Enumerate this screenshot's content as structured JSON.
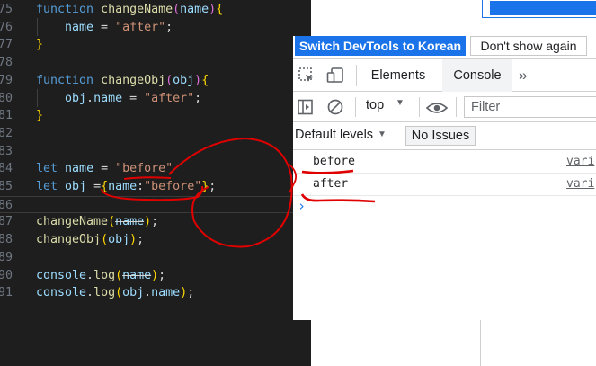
{
  "editor": {
    "lines": [
      {
        "num": "75",
        "tokens": [
          {
            "t": "function",
            "c": "kw"
          },
          {
            "t": " ",
            "c": "plain"
          },
          {
            "t": "changeName",
            "c": "fn"
          },
          {
            "t": "(",
            "c": "brace2"
          },
          {
            "t": "name",
            "c": "var"
          },
          {
            "t": ")",
            "c": "brace2"
          },
          {
            "t": "{",
            "c": "brace1"
          }
        ]
      },
      {
        "num": "76",
        "tokens": [
          {
            "t": "    name",
            "c": "var"
          },
          {
            "t": " = ",
            "c": "plain"
          },
          {
            "t": "\"after\"",
            "c": "str"
          },
          {
            "t": ";",
            "c": "plain"
          }
        ]
      },
      {
        "num": "77",
        "tokens": [
          {
            "t": "}",
            "c": "brace1"
          }
        ]
      },
      {
        "num": "78",
        "tokens": []
      },
      {
        "num": "79",
        "tokens": [
          {
            "t": "function",
            "c": "kw"
          },
          {
            "t": " ",
            "c": "plain"
          },
          {
            "t": "changeObj",
            "c": "fn"
          },
          {
            "t": "(",
            "c": "brace2"
          },
          {
            "t": "obj",
            "c": "var"
          },
          {
            "t": ")",
            "c": "brace2"
          },
          {
            "t": "{",
            "c": "brace1"
          }
        ]
      },
      {
        "num": "80",
        "tokens": [
          {
            "t": "    obj",
            "c": "var"
          },
          {
            "t": ".",
            "c": "plain"
          },
          {
            "t": "name",
            "c": "var"
          },
          {
            "t": " = ",
            "c": "plain"
          },
          {
            "t": "\"after\"",
            "c": "str"
          },
          {
            "t": ";",
            "c": "plain"
          }
        ]
      },
      {
        "num": "81",
        "tokens": [
          {
            "t": "}",
            "c": "brace1"
          }
        ]
      },
      {
        "num": "82",
        "tokens": []
      },
      {
        "num": "83",
        "tokens": []
      },
      {
        "num": "84",
        "tokens": [
          {
            "t": "let",
            "c": "kw"
          },
          {
            "t": " ",
            "c": "plain"
          },
          {
            "t": "name",
            "c": "var"
          },
          {
            "t": " = ",
            "c": "plain"
          },
          {
            "t": "\"before\"",
            "c": "str"
          }
        ]
      },
      {
        "num": "85",
        "tokens": [
          {
            "t": "let",
            "c": "kw"
          },
          {
            "t": " ",
            "c": "plain"
          },
          {
            "t": "obj",
            "c": "var"
          },
          {
            "t": " =",
            "c": "plain"
          },
          {
            "t": "{",
            "c": "brace1"
          },
          {
            "t": "name",
            "c": "var"
          },
          {
            "t": ":",
            "c": "plain"
          },
          {
            "t": "\"before\"",
            "c": "str"
          },
          {
            "t": "}",
            "c": "brace1"
          },
          {
            "t": ";",
            "c": "plain"
          }
        ]
      },
      {
        "num": "86",
        "tokens": [],
        "current": true
      },
      {
        "num": "87",
        "tokens": [
          {
            "t": "changeName",
            "c": "fn"
          },
          {
            "t": "(",
            "c": "brace1"
          },
          {
            "t": "name",
            "c": "var strike"
          },
          {
            "t": ")",
            "c": "brace1"
          },
          {
            "t": ";",
            "c": "plain"
          }
        ]
      },
      {
        "num": "88",
        "tokens": [
          {
            "t": "changeObj",
            "c": "fn"
          },
          {
            "t": "(",
            "c": "brace1"
          },
          {
            "t": "obj",
            "c": "var"
          },
          {
            "t": ")",
            "c": "brace1"
          },
          {
            "t": ";",
            "c": "plain"
          }
        ]
      },
      {
        "num": "89",
        "tokens": []
      },
      {
        "num": "90",
        "tokens": [
          {
            "t": "console",
            "c": "var"
          },
          {
            "t": ".",
            "c": "plain"
          },
          {
            "t": "log",
            "c": "fn"
          },
          {
            "t": "(",
            "c": "brace1"
          },
          {
            "t": "name",
            "c": "var strike"
          },
          {
            "t": ")",
            "c": "brace1"
          },
          {
            "t": ";",
            "c": "plain"
          }
        ]
      },
      {
        "num": "91",
        "tokens": [
          {
            "t": "console",
            "c": "var"
          },
          {
            "t": ".",
            "c": "plain"
          },
          {
            "t": "log",
            "c": "fn"
          },
          {
            "t": "(",
            "c": "brace1"
          },
          {
            "t": "obj",
            "c": "var"
          },
          {
            "t": ".",
            "c": "plain"
          },
          {
            "t": "name",
            "c": "var"
          },
          {
            "t": ")",
            "c": "brace1"
          },
          {
            "t": ";",
            "c": "plain"
          }
        ]
      }
    ]
  },
  "devtools": {
    "lang_bar": {
      "switch_label": "Switch DevTools to Korean",
      "dont_show_label": "Don't show again"
    },
    "tabs": [
      {
        "label": "Elements",
        "active": false
      },
      {
        "label": "Console",
        "active": true
      }
    ],
    "more_tabs": "»",
    "toolbar": {
      "context": "top",
      "filter_placeholder": "Filter"
    },
    "levels_label": "Default levels",
    "issues_label": "No Issues",
    "console": [
      {
        "text": "before",
        "source": "vari"
      },
      {
        "text": "after",
        "source": "vari"
      }
    ],
    "prompt": "›"
  },
  "colors": {
    "editor_bg": "#1e1e1e",
    "accent": "#1a73e8",
    "annotation": "#e00000"
  },
  "icons": [
    "inspect-element-icon",
    "device-toolbar-icon",
    "more-tabs-icon",
    "sidebar-toggle-icon",
    "clear-console-icon",
    "dropdown-arrow-icon",
    "eye-icon",
    "console-prompt-icon"
  ]
}
